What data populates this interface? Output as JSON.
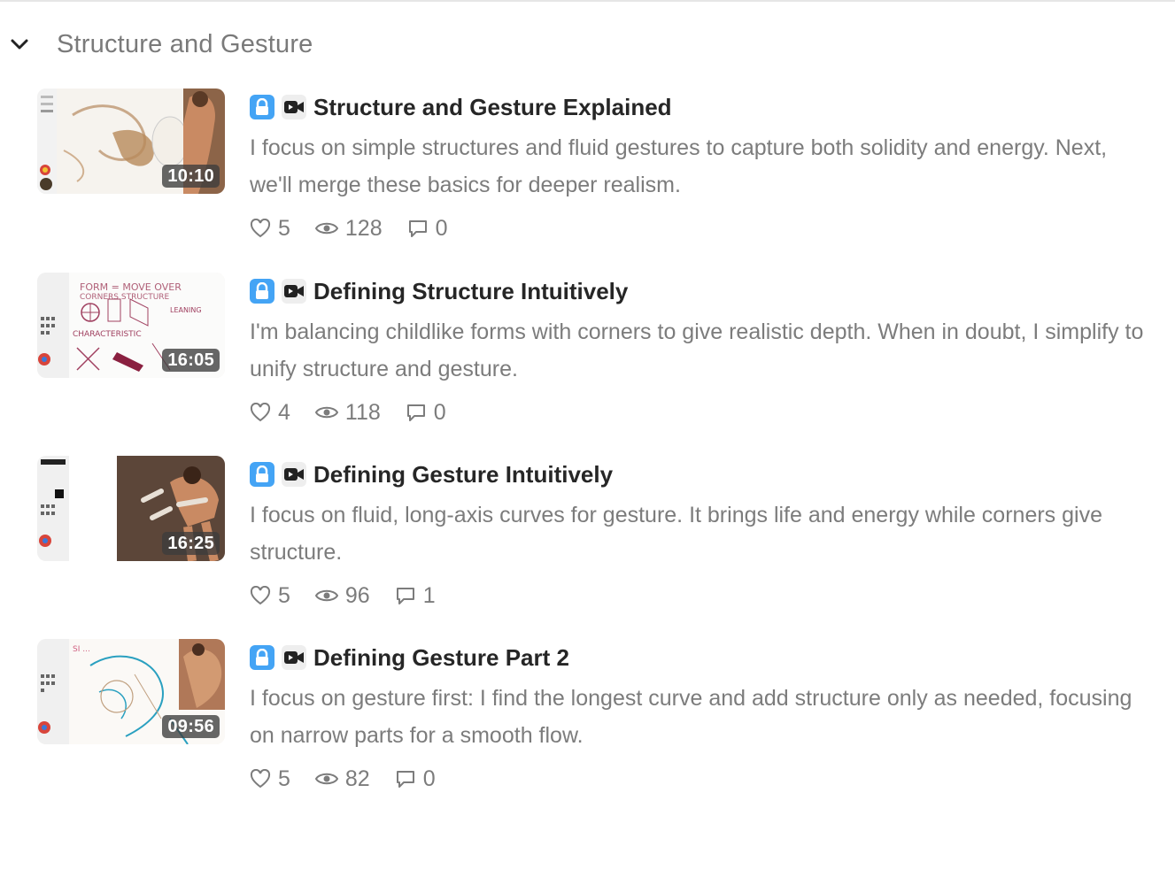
{
  "section": {
    "title": "Structure and Gesture",
    "expand_icon": "chevron-down-icon"
  },
  "icons": {
    "lock": "lock-icon",
    "video": "video-camera-icon",
    "like": "heart-icon",
    "views": "eye-icon",
    "comments": "comment-icon"
  },
  "colors": {
    "lock_badge": "#44a4f5",
    "title_text": "#262626",
    "muted_text": "#7c7c7c"
  },
  "lessons": [
    {
      "title": "Structure and Gesture Explained",
      "description": "I focus on simple structures and fluid gestures to capture both solidity and energy. Next, we'll merge these basics for deeper realism.",
      "duration": "10:10",
      "likes": "5",
      "views": "128",
      "comments": "0"
    },
    {
      "title": "Defining Structure Intuitively",
      "description": "I'm balancing childlike forms with corners to give realistic depth. When in doubt, I simplify to unify structure and gesture.",
      "duration": "16:05",
      "likes": "4",
      "views": "118",
      "comments": "0"
    },
    {
      "title": "Defining Gesture Intuitively",
      "description": "I focus on fluid, long-axis curves for gesture. It brings life and energy while corners give structure.",
      "duration": "16:25",
      "likes": "5",
      "views": "96",
      "comments": "1"
    },
    {
      "title": "Defining Gesture Part 2",
      "description": "I focus on gesture first: I find the longest curve and add structure only as needed, focusing on narrow parts for a smooth flow.",
      "duration": "09:56",
      "likes": "5",
      "views": "82",
      "comments": "0"
    }
  ]
}
